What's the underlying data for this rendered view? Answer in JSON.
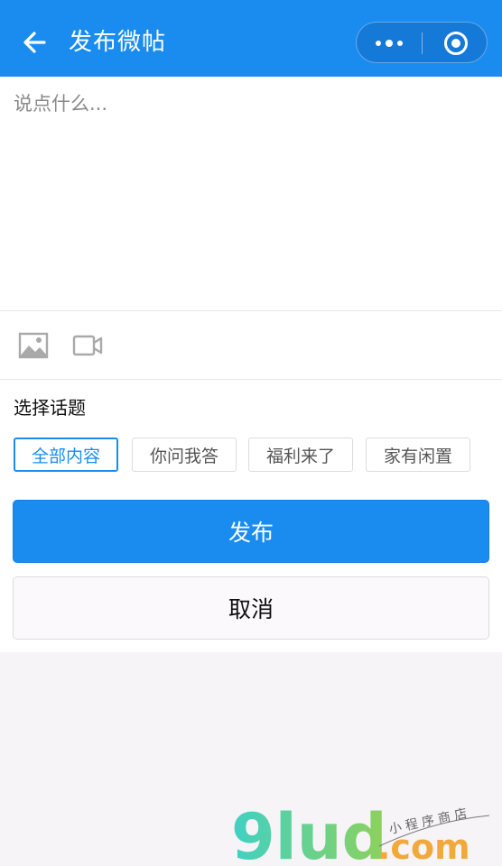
{
  "navbar": {
    "title": "发布微帖",
    "back_icon": "arrow-left-icon",
    "more_icon": "more-dots-icon",
    "close_icon": "target-circle-icon",
    "background_color": "#1a8cf0"
  },
  "editor": {
    "placeholder": "说点什么...",
    "value": ""
  },
  "media": {
    "image_icon": "image-icon",
    "video_icon": "video-camera-icon"
  },
  "topics": {
    "label": "选择话题",
    "items": [
      {
        "label": "全部内容",
        "selected": true
      },
      {
        "label": "你问我答",
        "selected": false
      },
      {
        "label": "福利来了",
        "selected": false
      },
      {
        "label": "家有闲置",
        "selected": false
      }
    ]
  },
  "actions": {
    "publish_label": "发布",
    "cancel_label": "取消"
  },
  "watermark": {
    "brand": "9lud",
    "domain": ".com",
    "tagline": "小程序商店"
  },
  "colors": {
    "accent": "#1a8cf0",
    "background": "#f7f4f7"
  }
}
